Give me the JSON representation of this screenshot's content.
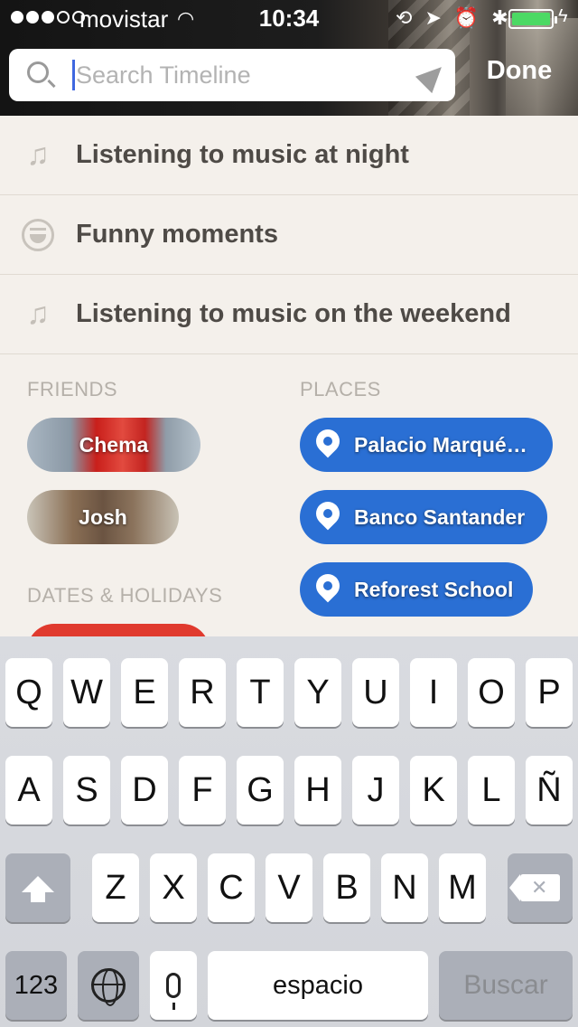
{
  "status_bar": {
    "carrier": "movistar",
    "time": "10:34",
    "signal_bars_filled": 3,
    "signal_bars_total": 5,
    "battery_level": 1.0
  },
  "search": {
    "placeholder": "Search Timeline",
    "value": "",
    "done_label": "Done"
  },
  "suggestions": [
    {
      "icon": "music-note-icon",
      "label": "Listening to music at night"
    },
    {
      "icon": "laughing-face-icon",
      "label": "Funny moments"
    },
    {
      "icon": "music-note-icon",
      "label": "Listening to music on the weekend"
    }
  ],
  "friends": {
    "title": "FRIENDS",
    "items": [
      "Chema",
      "Josh"
    ]
  },
  "places": {
    "title": "PLACES",
    "items": [
      "Palacio Marqué…",
      "Banco Santander",
      "Reforest School"
    ]
  },
  "dates": {
    "title": "DATES & HOLIDAYS"
  },
  "keyboard": {
    "row1": [
      "Q",
      "W",
      "E",
      "R",
      "T",
      "Y",
      "U",
      "I",
      "O",
      "P"
    ],
    "row2": [
      "A",
      "S",
      "D",
      "F",
      "G",
      "H",
      "J",
      "K",
      "L",
      "Ñ"
    ],
    "row3": [
      "Z",
      "X",
      "C",
      "V",
      "B",
      "N",
      "M"
    ],
    "numbers_label": "123",
    "space_label": "espacio",
    "action_label": "Buscar"
  },
  "colors": {
    "place_pill": "#2a6fd4",
    "battery": "#4cd964",
    "date_pill": "#e03a2e"
  }
}
